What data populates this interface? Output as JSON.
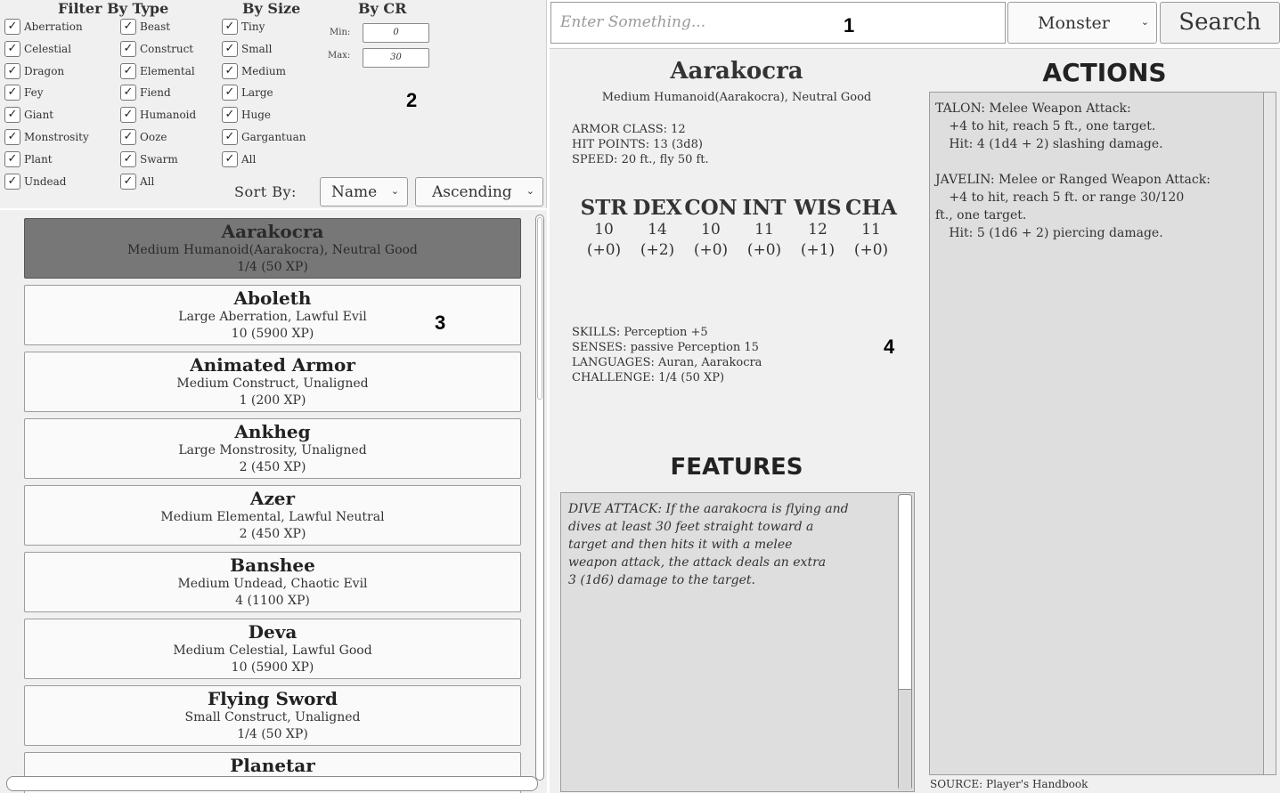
{
  "filters": {
    "type_title": "Filter By Type",
    "size_title": "By Size",
    "cr_title": "By CR",
    "types_col1": [
      "Aberration",
      "Celestial",
      "Dragon",
      "Fey",
      "Giant",
      "Monstrosity",
      "Plant",
      "Undead"
    ],
    "types_col2": [
      "Beast",
      "Construct",
      "Elemental",
      "Fiend",
      "Humanoid",
      "Ooze",
      "Swarm",
      "All"
    ],
    "sizes": [
      "Tiny",
      "Small",
      "Medium",
      "Large",
      "Huge",
      "Gargantuan",
      "All"
    ],
    "cr_min_label": "Min:",
    "cr_min_value": "0",
    "cr_max_label": "Max:",
    "cr_max_value": "30",
    "check_glyph": "✓"
  },
  "sort": {
    "label": "Sort By:",
    "field": "Name",
    "order": "Ascending"
  },
  "markers": [
    "1",
    "2",
    "3",
    "4"
  ],
  "monster_list": [
    {
      "name": "Aarakocra",
      "type": "Medium Humanoid(Aarakocra), Neutral Good",
      "cr": "1/4 (50 XP)",
      "selected": true
    },
    {
      "name": "Aboleth",
      "type": "Large Aberration, Lawful Evil",
      "cr": "10 (5900 XP)",
      "selected": false
    },
    {
      "name": "Animated Armor",
      "type": "Medium Construct, Unaligned",
      "cr": "1 (200 XP)",
      "selected": false
    },
    {
      "name": "Ankheg",
      "type": "Large Monstrosity, Unaligned",
      "cr": "2 (450 XP)",
      "selected": false
    },
    {
      "name": "Azer",
      "type": "Medium Elemental, Lawful Neutral",
      "cr": "2 (450 XP)",
      "selected": false
    },
    {
      "name": "Banshee",
      "type": "Medium Undead, Chaotic Evil",
      "cr": "4 (1100 XP)",
      "selected": false
    },
    {
      "name": "Deva",
      "type": "Medium Celestial, Lawful Good",
      "cr": "10 (5900 XP)",
      "selected": false
    },
    {
      "name": "Flying Sword",
      "type": "Small Construct, Unaligned",
      "cr": "1/4 (50 XP)",
      "selected": false
    },
    {
      "name": "Planetar",
      "type": "",
      "cr": "",
      "selected": false
    }
  ],
  "search": {
    "placeholder": "Enter Something...",
    "category": "Monster",
    "button_label": "Search"
  },
  "detail": {
    "name": "Aarakocra",
    "subtitle": "Medium Humanoid(Aarakocra), Neutral Good",
    "armor_class": "ARMOR CLASS: 12",
    "hit_points": "HIT POINTS: 13 (3d8)",
    "speed": "SPEED: 20 ft., fly 50 ft.",
    "abilities": [
      {
        "key": "STR",
        "score": "10",
        "mod": "(+0)"
      },
      {
        "key": "DEX",
        "score": "14",
        "mod": "(+2)"
      },
      {
        "key": "CON",
        "score": "10",
        "mod": "(+0)"
      },
      {
        "key": "INT",
        "score": "11",
        "mod": "(+0)"
      },
      {
        "key": "WIS",
        "score": "12",
        "mod": "(+1)"
      },
      {
        "key": "CHA",
        "score": "11",
        "mod": "(+0)"
      }
    ],
    "skills": "SKILLS: Perception +5",
    "senses": "SENSES: passive Perception 15",
    "languages": "LANGUAGES: Auran, Aarakocra",
    "challenge": "CHALLENGE: 1/4 (50 XP)",
    "features_title": "FEATURES",
    "features_lines": [
      "DIVE ATTACK: If the aarakocra is flying and",
      "dives at least 30 feet straight toward a",
      "target and then hits it with a melee",
      "weapon attack, the attack deals an extra",
      "3 (1d6) damage to the target."
    ],
    "actions_title": "ACTIONS",
    "actions_lines": [
      "TALON: Melee Weapon Attack:",
      "   +4 to hit, reach 5 ft., one target.",
      "   Hit: 4 (1d4 + 2) slashing damage.",
      "",
      "JAVELIN: Melee or Ranged Weapon Attack:",
      "   +4 to hit, reach 5 ft. or range 30/120",
      "ft., one target.",
      "   Hit: 5 (1d6 + 2) piercing damage."
    ],
    "source": "SOURCE: Player's Handbook"
  }
}
